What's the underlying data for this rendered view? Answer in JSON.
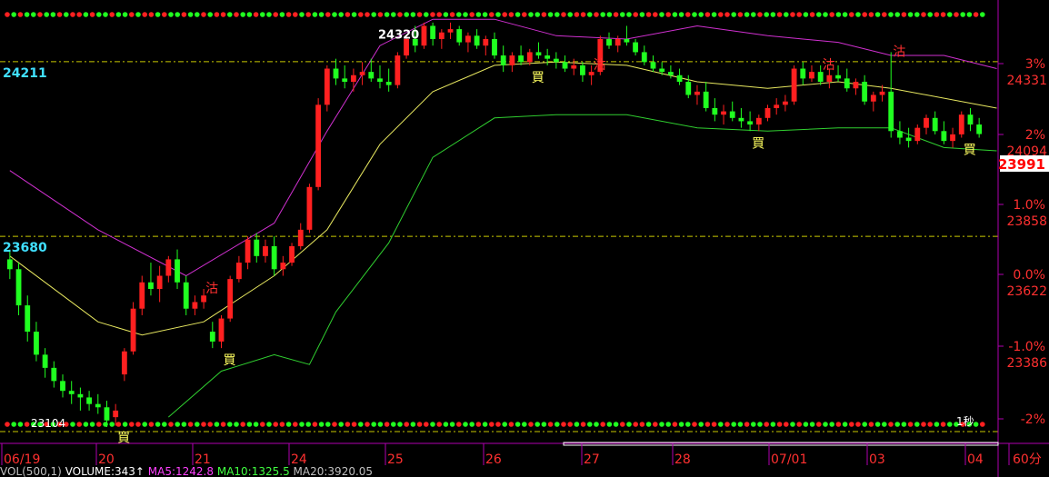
{
  "chart_data": {
    "type": "candlestick",
    "instrument_labels": {
      "level_hi": "24211",
      "level_lo": "23680",
      "peak": "24320",
      "trough": "23104"
    },
    "price_axis": [
      {
        "pct": "3%",
        "price": "24331"
      },
      {
        "pct": "2%",
        "price": "24094"
      },
      {
        "pct": "1.0%",
        "price": "23858"
      },
      {
        "pct": "0.0%",
        "price": "23622"
      },
      {
        "pct": "-1.0%",
        "price": "23386"
      },
      {
        "pct": "-2%",
        "price": ""
      }
    ],
    "last_price": "23991",
    "ylim": [
      23100,
      24360
    ],
    "date_ticks": [
      "06/19",
      "20",
      "21",
      "24",
      "25",
      "26",
      "27",
      "28",
      "07/01",
      "03",
      "04"
    ],
    "period_label": "60分",
    "signals": {
      "buy": "買",
      "sell": "沽",
      "seconds": "1秒"
    },
    "status_bar": [
      {
        "text": "VOL(500,1)",
        "color": "#c0c0c0"
      },
      {
        "text": "VOLUME:343↑",
        "color": "#ffffff"
      },
      {
        "text": "MA5:1242.8",
        "color": "#ff40ff"
      },
      {
        "text": "MA10:1325.5",
        "color": "#40ff40"
      },
      {
        "text": "MA20:3920.05",
        "color": "#c0c0c0"
      }
    ],
    "candles": [
      [
        23610,
        23640,
        23550,
        23580
      ],
      [
        23580,
        23600,
        23440,
        23470
      ],
      [
        23470,
        23500,
        23360,
        23390
      ],
      [
        23390,
        23420,
        23300,
        23320
      ],
      [
        23320,
        23340,
        23250,
        23280
      ],
      [
        23280,
        23300,
        23220,
        23240
      ],
      [
        23240,
        23260,
        23190,
        23210
      ],
      [
        23210,
        23240,
        23170,
        23200
      ],
      [
        23200,
        23220,
        23150,
        23190
      ],
      [
        23190,
        23210,
        23150,
        23170
      ],
      [
        23170,
        23200,
        23140,
        23160
      ],
      [
        23160,
        23180,
        23100,
        23120
      ],
      [
        23130,
        23170,
        23104,
        23150
      ],
      [
        23260,
        23340,
        23240,
        23330
      ],
      [
        23330,
        23480,
        23320,
        23460
      ],
      [
        23460,
        23560,
        23440,
        23540
      ],
      [
        23540,
        23600,
        23500,
        23520
      ],
      [
        23520,
        23590,
        23480,
        23560
      ],
      [
        23560,
        23620,
        23540,
        23610
      ],
      [
        23610,
        23640,
        23520,
        23540
      ],
      [
        23540,
        23560,
        23440,
        23460
      ],
      [
        23460,
        23500,
        23440,
        23480
      ],
      [
        23480,
        23520,
        23460,
        23500
      ],
      [
        23390,
        23420,
        23340,
        23360
      ],
      [
        23360,
        23440,
        23340,
        23430
      ],
      [
        23430,
        23560,
        23420,
        23550
      ],
      [
        23550,
        23620,
        23540,
        23600
      ],
      [
        23600,
        23680,
        23580,
        23670
      ],
      [
        23670,
        23690,
        23600,
        23620
      ],
      [
        23620,
        23670,
        23600,
        23650
      ],
      [
        23650,
        23680,
        23560,
        23580
      ],
      [
        23580,
        23620,
        23560,
        23600
      ],
      [
        23600,
        23660,
        23590,
        23650
      ],
      [
        23650,
        23720,
        23640,
        23700
      ],
      [
        23700,
        23840,
        23690,
        23830
      ],
      [
        23830,
        24100,
        23820,
        24080
      ],
      [
        24080,
        24200,
        24060,
        24190
      ],
      [
        24190,
        24220,
        24140,
        24160
      ],
      [
        24160,
        24200,
        24130,
        24150
      ],
      [
        24150,
        24190,
        24120,
        24170
      ],
      [
        24170,
        24210,
        24140,
        24180
      ],
      [
        24180,
        24220,
        24150,
        24160
      ],
      [
        24160,
        24200,
        24130,
        24150
      ],
      [
        24150,
        24190,
        24120,
        24140
      ],
      [
        24140,
        24240,
        24130,
        24230
      ],
      [
        24230,
        24290,
        24220,
        24280
      ],
      [
        24280,
        24320,
        24240,
        24260
      ],
      [
        24260,
        24330,
        24250,
        24320
      ],
      [
        24320,
        24330,
        24260,
        24280
      ],
      [
        24280,
        24310,
        24250,
        24300
      ],
      [
        24300,
        24330,
        24280,
        24310
      ],
      [
        24310,
        24320,
        24260,
        24270
      ],
      [
        24270,
        24300,
        24240,
        24290
      ],
      [
        24290,
        24310,
        24250,
        24260
      ],
      [
        24260,
        24290,
        24230,
        24280
      ],
      [
        24280,
        24300,
        24220,
        24230
      ],
      [
        24230,
        24260,
        24180,
        24200
      ],
      [
        24200,
        24240,
        24180,
        24230
      ],
      [
        24230,
        24260,
        24200,
        24210
      ],
      [
        24210,
        24250,
        24200,
        24240
      ],
      [
        24240,
        24270,
        24220,
        24230
      ],
      [
        24230,
        24250,
        24200,
        24220
      ],
      [
        24220,
        24240,
        24190,
        24210
      ],
      [
        24210,
        24230,
        24180,
        24190
      ],
      [
        24190,
        24220,
        24170,
        24200
      ],
      [
        24200,
        24210,
        24150,
        24170
      ],
      [
        24170,
        24200,
        24140,
        24180
      ],
      [
        24180,
        24290,
        24170,
        24280
      ],
      [
        24280,
        24300,
        24250,
        24260
      ],
      [
        24260,
        24290,
        24240,
        24280
      ],
      [
        24280,
        24320,
        24260,
        24270
      ],
      [
        24270,
        24280,
        24230,
        24240
      ],
      [
        24240,
        24260,
        24200,
        24210
      ],
      [
        24210,
        24230,
        24180,
        24190
      ],
      [
        24190,
        24210,
        24170,
        24180
      ],
      [
        24180,
        24200,
        24160,
        24170
      ],
      [
        24170,
        24190,
        24140,
        24150
      ],
      [
        24150,
        24170,
        24100,
        24110
      ],
      [
        24110,
        24140,
        24080,
        24120
      ],
      [
        24120,
        24150,
        24060,
        24070
      ],
      [
        24070,
        24100,
        24030,
        24050
      ],
      [
        24050,
        24080,
        24020,
        24060
      ],
      [
        24060,
        24090,
        24030,
        24040
      ],
      [
        24040,
        24070,
        24010,
        24030
      ],
      [
        24030,
        24060,
        24000,
        24020
      ],
      [
        24020,
        24050,
        24000,
        24040
      ],
      [
        24040,
        24080,
        24030,
        24070
      ],
      [
        24070,
        24100,
        24050,
        24080
      ],
      [
        24080,
        24110,
        24060,
        24090
      ],
      [
        24090,
        24200,
        24080,
        24190
      ],
      [
        24190,
        24210,
        24140,
        24160
      ],
      [
        24160,
        24200,
        24150,
        24180
      ],
      [
        24180,
        24200,
        24140,
        24150
      ],
      [
        24150,
        24190,
        24130,
        24170
      ],
      [
        24170,
        24200,
        24150,
        24160
      ],
      [
        24160,
        24190,
        24120,
        24130
      ],
      [
        24130,
        24160,
        24110,
        24150
      ],
      [
        24150,
        24170,
        24080,
        24090
      ],
      [
        24090,
        24120,
        24060,
        24110
      ],
      [
        24110,
        24140,
        24090,
        24120
      ],
      [
        24120,
        24240,
        23980,
        24000
      ],
      [
        24000,
        24030,
        23960,
        23980
      ],
      [
        23980,
        24010,
        23950,
        23970
      ],
      [
        23970,
        24020,
        23960,
        24010
      ],
      [
        24010,
        24050,
        23990,
        24040
      ],
      [
        24040,
        24060,
        23990,
        24000
      ],
      [
        24000,
        24030,
        23960,
        23970
      ],
      [
        23970,
        24010,
        23950,
        23990
      ],
      [
        23990,
        24060,
        23980,
        24050
      ],
      [
        24050,
        24070,
        24000,
        24020
      ],
      [
        24020,
        24040,
        23980,
        23991
      ]
    ],
    "bollinger": {
      "upper": [
        [
          0,
          23880
        ],
        [
          10,
          23700
        ],
        [
          20,
          23560
        ],
        [
          30,
          23720
        ],
        [
          36,
          24000
        ],
        [
          42,
          24260
        ],
        [
          48,
          24340
        ],
        [
          55,
          24340
        ],
        [
          62,
          24290
        ],
        [
          70,
          24280
        ],
        [
          78,
          24320
        ],
        [
          86,
          24290
        ],
        [
          94,
          24270
        ],
        [
          100,
          24230
        ],
        [
          106,
          24230
        ],
        [
          112,
          24190
        ]
      ],
      "middle": [
        [
          0,
          23620
        ],
        [
          10,
          23420
        ],
        [
          15,
          23380
        ],
        [
          22,
          23420
        ],
        [
          30,
          23560
        ],
        [
          36,
          23700
        ],
        [
          42,
          23960
        ],
        [
          48,
          24120
        ],
        [
          55,
          24200
        ],
        [
          62,
          24210
        ],
        [
          70,
          24200
        ],
        [
          78,
          24150
        ],
        [
          86,
          24130
        ],
        [
          94,
          24150
        ],
        [
          100,
          24130
        ],
        [
          112,
          24070
        ]
      ],
      "lower": [
        [
          18,
          23130
        ],
        [
          24,
          23270
        ],
        [
          30,
          23320
        ],
        [
          34,
          23290
        ],
        [
          37,
          23450
        ],
        [
          43,
          23660
        ],
        [
          48,
          23920
        ],
        [
          55,
          24040
        ],
        [
          62,
          24050
        ],
        [
          70,
          24050
        ],
        [
          78,
          24010
        ],
        [
          86,
          24000
        ],
        [
          94,
          24010
        ],
        [
          100,
          24010
        ],
        [
          106,
          23950
        ],
        [
          112,
          23940
        ]
      ]
    },
    "buy_marks": [
      12,
      24,
      59,
      84,
      108
    ],
    "sell_marks": [
      22,
      66,
      92,
      100
    ]
  }
}
